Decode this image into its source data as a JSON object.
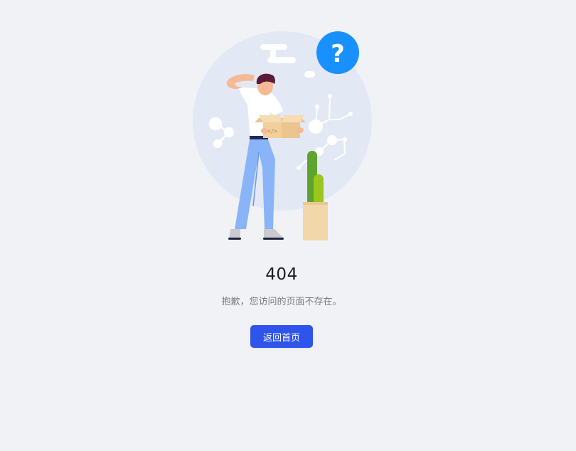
{
  "error": {
    "code": "404",
    "message": "抱歉，您访问的页面不存在。",
    "home_button_label": "返回首页"
  },
  "illustration": {
    "icons": [
      "question-mark-icon",
      "box-code-icon",
      "cactus-icon"
    ],
    "colors": {
      "circle": "#e3e8f5",
      "question_badge": "#1890ff",
      "button": "#2f54eb",
      "pants": "#8ab4f8",
      "box": "#f3cf9c",
      "cactus": "#5ea32e",
      "pot": "#f2d7aa"
    }
  }
}
